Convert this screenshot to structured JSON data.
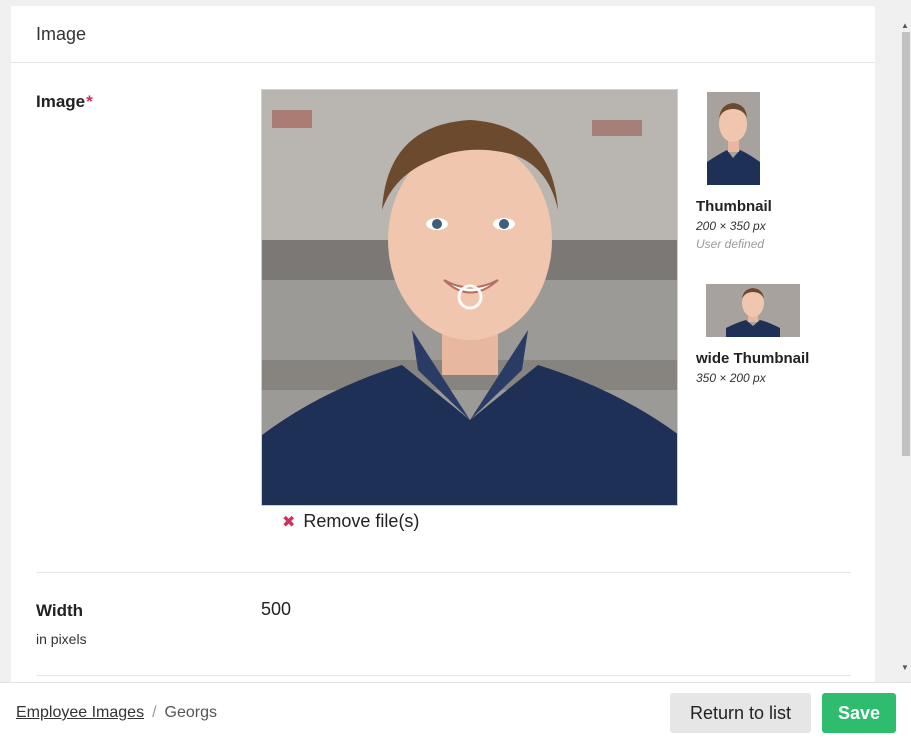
{
  "panel": {
    "title": "Image"
  },
  "image_field": {
    "label": "Image",
    "required_mark": "*",
    "remove_label": "Remove file(s)",
    "remove_icon": "close-icon"
  },
  "thumbnails": [
    {
      "title": "Thumbnail",
      "dimensions": "200 × 350 px",
      "note": "User defined"
    },
    {
      "title": "wide Thumbnail",
      "dimensions": "350 × 200 px",
      "note": ""
    }
  ],
  "width_field": {
    "label": "Width",
    "sub_label": "in pixels",
    "value": "500"
  },
  "breadcrumb": {
    "link": "Employee Images",
    "separator": "/",
    "current": "Georgs"
  },
  "actions": {
    "return_label": "Return to list",
    "save_label": "Save"
  },
  "colors": {
    "accent_save": "#2ebd6f",
    "required": "#d0315a",
    "shirt": "#1f3056"
  }
}
